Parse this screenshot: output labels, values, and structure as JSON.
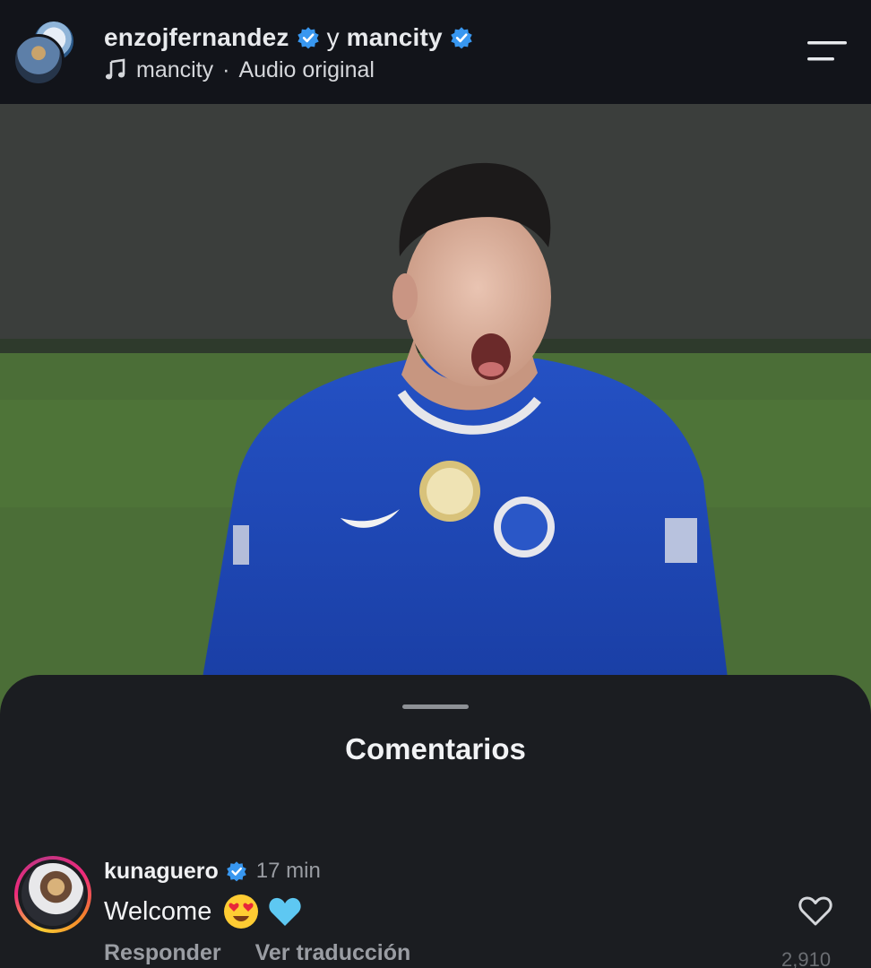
{
  "header": {
    "user1": "enzojfernandez",
    "connector": "y",
    "user2": "mancity",
    "audio_account": "mancity",
    "audio_sep": "·",
    "audio_label": "Audio original"
  },
  "sheet": {
    "title": "Comentarios"
  },
  "comment": {
    "username": "kunaguero",
    "time": "17 min",
    "text": "Welcome",
    "reply_label": "Responder",
    "translate_label": "Ver traducción",
    "like_count": "2,910"
  },
  "colors": {
    "verified_blue": "#3897f0",
    "background": "#121417",
    "sheet": "#1b1d21",
    "shirt_blue": "#1d4bb8"
  },
  "icons": {
    "menu": "menu-icon",
    "music": "music-note-icon",
    "verified": "verified-badge-icon",
    "like": "heart-outline-icon"
  }
}
